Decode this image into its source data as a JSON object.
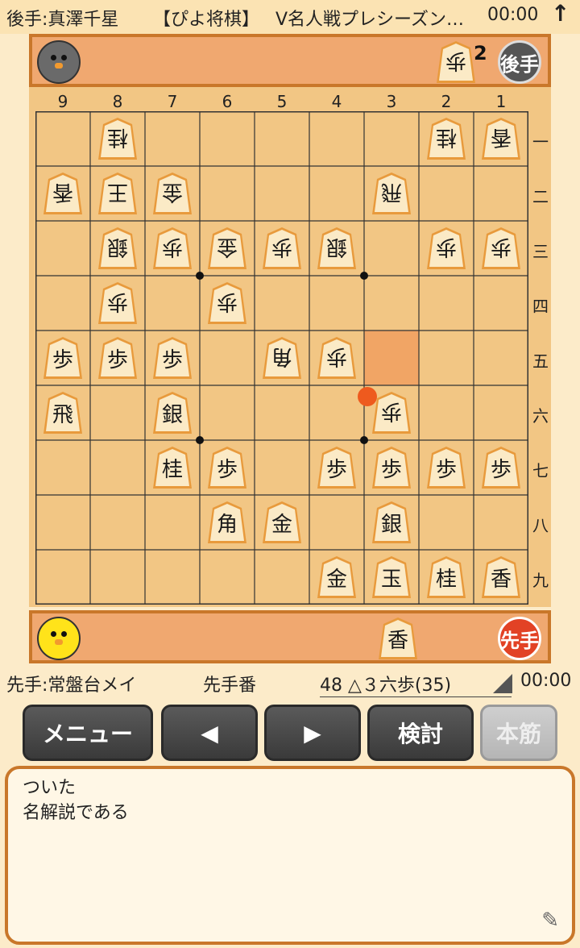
{
  "header": {
    "gote_name": "後手:真澤千星",
    "app_title": "【ぴよ将棋】",
    "match_title": "V名人戦プレシーズン…",
    "gote_time": "00:00",
    "up_icon": "↑"
  },
  "gote_stand": {
    "badge": "後手",
    "hand": [
      {
        "piece": "歩",
        "count": "2"
      }
    ]
  },
  "sente_stand": {
    "badge": "先手",
    "hand": [
      {
        "piece": "香"
      }
    ]
  },
  "board": {
    "files": [
      "9",
      "8",
      "7",
      "6",
      "5",
      "4",
      "3",
      "2",
      "1"
    ],
    "ranks": [
      "一",
      "二",
      "三",
      "四",
      "五",
      "六",
      "七",
      "八",
      "九"
    ],
    "pieces": [
      {
        "f": 8,
        "r": 1,
        "ch": "桂",
        "owner": "gote"
      },
      {
        "f": 2,
        "r": 1,
        "ch": "桂",
        "owner": "gote"
      },
      {
        "f": 1,
        "r": 1,
        "ch": "香",
        "owner": "gote"
      },
      {
        "f": 9,
        "r": 2,
        "ch": "香",
        "owner": "gote"
      },
      {
        "f": 8,
        "r": 2,
        "ch": "王",
        "owner": "gote"
      },
      {
        "f": 7,
        "r": 2,
        "ch": "金",
        "owner": "gote"
      },
      {
        "f": 3,
        "r": 2,
        "ch": "飛",
        "owner": "gote"
      },
      {
        "f": 8,
        "r": 3,
        "ch": "銀",
        "owner": "gote"
      },
      {
        "f": 7,
        "r": 3,
        "ch": "歩",
        "owner": "gote"
      },
      {
        "f": 6,
        "r": 3,
        "ch": "金",
        "owner": "gote"
      },
      {
        "f": 5,
        "r": 3,
        "ch": "歩",
        "owner": "gote"
      },
      {
        "f": 4,
        "r": 3,
        "ch": "銀",
        "owner": "gote"
      },
      {
        "f": 2,
        "r": 3,
        "ch": "歩",
        "owner": "gote"
      },
      {
        "f": 1,
        "r": 3,
        "ch": "歩",
        "owner": "gote"
      },
      {
        "f": 8,
        "r": 4,
        "ch": "歩",
        "owner": "gote"
      },
      {
        "f": 6,
        "r": 4,
        "ch": "歩",
        "owner": "gote"
      },
      {
        "f": 9,
        "r": 5,
        "ch": "歩",
        "owner": "sente"
      },
      {
        "f": 8,
        "r": 5,
        "ch": "歩",
        "owner": "sente"
      },
      {
        "f": 7,
        "r": 5,
        "ch": "歩",
        "owner": "sente"
      },
      {
        "f": 5,
        "r": 5,
        "ch": "角",
        "owner": "gote"
      },
      {
        "f": 4,
        "r": 5,
        "ch": "歩",
        "owner": "gote"
      },
      {
        "f": 9,
        "r": 6,
        "ch": "飛",
        "owner": "sente"
      },
      {
        "f": 7,
        "r": 6,
        "ch": "銀",
        "owner": "sente"
      },
      {
        "f": 3,
        "r": 6,
        "ch": "歩",
        "owner": "gote"
      },
      {
        "f": 7,
        "r": 7,
        "ch": "桂",
        "owner": "sente"
      },
      {
        "f": 6,
        "r": 7,
        "ch": "歩",
        "owner": "sente"
      },
      {
        "f": 4,
        "r": 7,
        "ch": "歩",
        "owner": "sente"
      },
      {
        "f": 3,
        "r": 7,
        "ch": "歩",
        "owner": "sente"
      },
      {
        "f": 2,
        "r": 7,
        "ch": "歩",
        "owner": "sente"
      },
      {
        "f": 1,
        "r": 7,
        "ch": "歩",
        "owner": "sente"
      },
      {
        "f": 6,
        "r": 8,
        "ch": "角",
        "owner": "sente"
      },
      {
        "f": 5,
        "r": 8,
        "ch": "金",
        "owner": "sente"
      },
      {
        "f": 3,
        "r": 8,
        "ch": "銀",
        "owner": "sente"
      },
      {
        "f": 4,
        "r": 9,
        "ch": "金",
        "owner": "sente"
      },
      {
        "f": 3,
        "r": 9,
        "ch": "玉",
        "owner": "sente"
      },
      {
        "f": 2,
        "r": 9,
        "ch": "桂",
        "owner": "sente"
      },
      {
        "f": 1,
        "r": 9,
        "ch": "香",
        "owner": "sente"
      }
    ],
    "last_move_from": {
      "f": 3,
      "r": 5
    },
    "last_move_to": {
      "f": 3,
      "r": 6
    },
    "highlight_color": "#f08a4c",
    "dot_color": "#ee5a1e"
  },
  "status": {
    "sente_name": "先手:常盤台メイ",
    "turn": "先手番",
    "move": "48 △３六歩(35)",
    "sente_time": "00:00"
  },
  "buttons": {
    "menu": "メニュー",
    "prev": "◀",
    "next": "▶",
    "kento": "検討",
    "honsuji": "本筋"
  },
  "comment": {
    "lines": [
      "ついた",
      "名解説である"
    ],
    "edit_icon": "pencil-icon"
  }
}
